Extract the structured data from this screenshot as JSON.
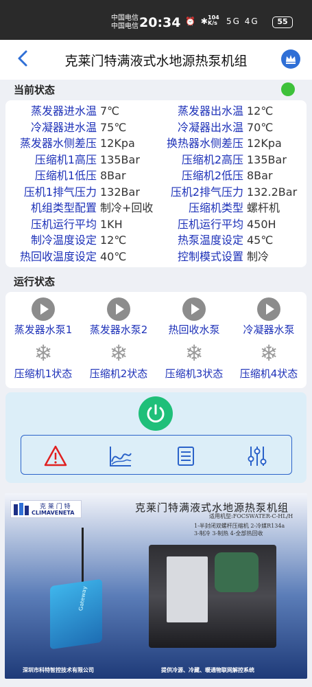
{
  "status_bar": {
    "carrier1": "中国电信",
    "carrier2": "中国电信",
    "time": "20:34",
    "speed_value": "104",
    "speed_unit": "K/s",
    "signal_icons": "5G 4G",
    "battery": "55"
  },
  "header": {
    "title": "克莱门特满液式水地源热泵机组"
  },
  "current_status": {
    "title": "当前状态",
    "indicator_color": "#3ec13a",
    "rows": [
      {
        "l1": "蒸发器进水温",
        "v1": "7℃",
        "l2": "蒸发器出水温",
        "v2": "12℃"
      },
      {
        "l1": "冷凝器进水温",
        "v1": "75℃",
        "l2": "冷凝器出水温",
        "v2": "70℃"
      },
      {
        "l1": "蒸发器水侧差压",
        "v1": "12Kpa",
        "l2": "换热器水侧差压",
        "v2": "12Kpa"
      },
      {
        "l1": "压缩机1高压",
        "v1": "135Bar",
        "l2": "压缩机2高压",
        "v2": "135Bar"
      },
      {
        "l1": "压缩机1低压",
        "v1": "8Bar",
        "l2": "压缩机2低压",
        "v2": "8Bar"
      },
      {
        "l1": "压机1排气压力",
        "v1": "132Bar",
        "l2": "压机2排气压力",
        "v2": "132.2Bar"
      },
      {
        "l1": "机组类型配置",
        "v1": "制冷+回收",
        "l2": "压缩机类型",
        "v2": "螺杆机"
      },
      {
        "l1": "压机运行平均",
        "v1": "1KH",
        "l2": "压机运行平均",
        "v2": "450H"
      },
      {
        "l1": "制冷温度设定",
        "v1": "12℃",
        "l2": "热泵温度设定",
        "v2": "45℃"
      },
      {
        "l1": "热回收温度设定",
        "v1": "40℃",
        "l2": "控制模式设置",
        "v2": "制冷"
      }
    ]
  },
  "run_status": {
    "title": "运行状态",
    "pumps": [
      {
        "label": "蒸发器水泵1",
        "icon": "play-icon"
      },
      {
        "label": "蒸发器水泵2",
        "icon": "play-icon"
      },
      {
        "label": "热回收水泵",
        "icon": "play-icon"
      },
      {
        "label": "冷凝器水泵",
        "icon": "play-icon"
      }
    ],
    "compressors": [
      {
        "label": "压缩机1状态",
        "icon": "snowflake-icon"
      },
      {
        "label": "压缩机2状态",
        "icon": "snowflake-icon"
      },
      {
        "label": "压缩机3状态",
        "icon": "snowflake-icon"
      },
      {
        "label": "压缩机4状态",
        "icon": "snowflake-icon"
      }
    ]
  },
  "controls": {
    "power_icon": "power-icon",
    "power_color": "#1fbf79",
    "tools": [
      "alarm-icon",
      "chart-icon",
      "list-icon",
      "settings-sliders-icon"
    ]
  },
  "banner": {
    "logo_cn": "克 莱 门 特",
    "logo_en": "CLIMAVENETA",
    "title": "克莱门特满液式水地源热泵机组",
    "model": "适用机型:FOCSWATER-C-HL/H",
    "features_1": "1-半封闭双螺杆压缩机 2-冷媒R134a",
    "features_2": "3-制冷 3-制热 4-全部热回收",
    "footer_left": "深圳市科特智控技术有限公司",
    "footer_right": "提供冷源、冷藏、暖通物联网解控系统"
  }
}
